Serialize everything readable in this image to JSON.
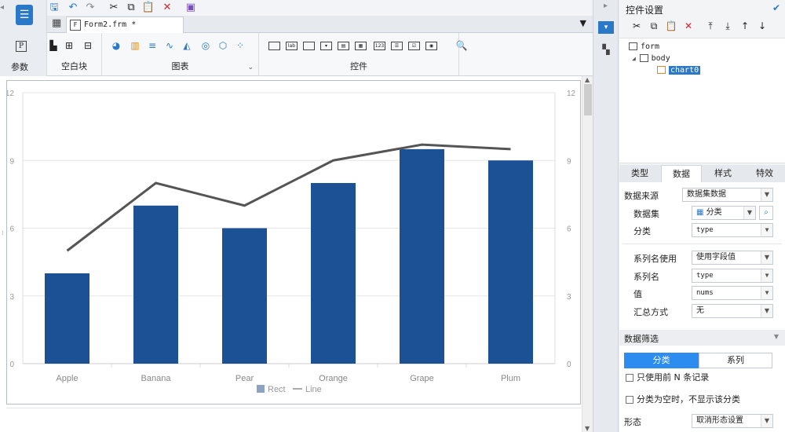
{
  "left_strip": {
    "param_label": "参数"
  },
  "tab_bar": {
    "file_tab_label": "Form2.frm *"
  },
  "ribbon": {
    "groups": [
      {
        "label": "空白块"
      },
      {
        "label": "图表"
      },
      {
        "label": "控件"
      }
    ]
  },
  "panel": {
    "title": "控件设置",
    "tree": {
      "root": "form",
      "body": "body",
      "chart": "chart0"
    },
    "tabs": [
      "类型",
      "数据",
      "样式",
      "特效"
    ],
    "active_tab": "数据",
    "fields": {
      "data_source": {
        "label": "数据来源",
        "value": "数据集数据"
      },
      "dataset": {
        "label": "数据集",
        "value": "分类"
      },
      "category": {
        "label": "分类",
        "value": "type"
      },
      "series_name_use": {
        "label": "系列名使用",
        "value": "使用字段值"
      },
      "series_name": {
        "label": "系列名",
        "value": "type"
      },
      "value": {
        "label": "值",
        "value": "nums"
      },
      "summary": {
        "label": "汇总方式",
        "value": "无"
      }
    },
    "filter": {
      "title": "数据筛选",
      "segments": [
        "分类",
        "系列"
      ],
      "check1": "只使用前 N 条记录",
      "check2": "分类为空时，不显示该分类"
    },
    "shape": {
      "label": "形态",
      "value": "取消形态设置"
    }
  },
  "colors": {
    "bar": "#1c5196",
    "line": "#555555",
    "accent": "#2a79c9"
  },
  "chart_data": {
    "type": "bar",
    "categories": [
      "Apple",
      "Banana",
      "Pear",
      "Orange",
      "Grape",
      "Plum"
    ],
    "series": [
      {
        "name": "Rect",
        "kind": "bar",
        "values": [
          4,
          7,
          6,
          8,
          9.5,
          9
        ]
      },
      {
        "name": "Line",
        "kind": "line",
        "values": [
          5,
          8,
          7,
          9,
          9.7,
          9.5
        ]
      }
    ],
    "yticks": [
      "0",
      "3",
      "6",
      "9",
      "12"
    ],
    "ylim": [
      0,
      12
    ],
    "grid": true,
    "legend": "bottom",
    "title": "",
    "xlabel": "",
    "ylabel": ""
  }
}
